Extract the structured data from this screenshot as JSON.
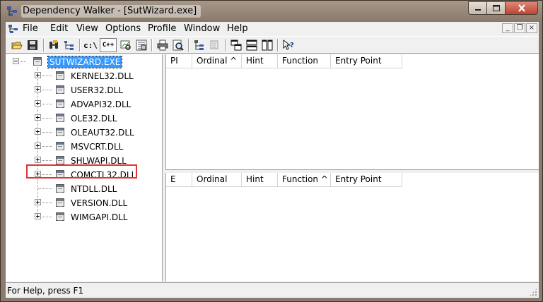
{
  "window": {
    "title": "Dependency Walker - [SutWizard.exe]"
  },
  "menu": {
    "items": [
      "File",
      "Edit",
      "View",
      "Options",
      "Profile",
      "Window",
      "Help"
    ]
  },
  "mdi_controls": [
    "_",
    "❐",
    "×"
  ],
  "toolbar": {
    "path_button": "c:\\",
    "cpp_button": "C++"
  },
  "tree": {
    "root": "SUTWIZARD.EXE",
    "children": [
      {
        "label": "KERNEL32.DLL",
        "expandable": true
      },
      {
        "label": "USER32.DLL",
        "expandable": true
      },
      {
        "label": "ADVAPI32.DLL",
        "expandable": true
      },
      {
        "label": "OLE32.DLL",
        "expandable": true
      },
      {
        "label": "OLEAUT32.DLL",
        "expandable": true
      },
      {
        "label": "MSVCRT.DLL",
        "expandable": true,
        "highlighted": true
      },
      {
        "label": "SHLWAPI.DLL",
        "expandable": true
      },
      {
        "label": "COMCTL32.DLL",
        "expandable": true
      },
      {
        "label": "NTDLL.DLL",
        "expandable": false
      },
      {
        "label": "VERSION.DLL",
        "expandable": true
      },
      {
        "label": "WIMGAPI.DLL",
        "expandable": true
      }
    ]
  },
  "imports_list": {
    "columns": [
      "PI",
      "Ordinal ^",
      "Hint",
      "Function",
      "Entry Point"
    ]
  },
  "exports_list": {
    "columns": [
      "E",
      "Ordinal",
      "Hint",
      "Function ^",
      "Entry Point"
    ]
  },
  "status": {
    "text": "For Help, press F1"
  },
  "colors": {
    "selection": "#3399ff",
    "highlight_box": "#e03434",
    "frame": "#8b7b6e"
  }
}
